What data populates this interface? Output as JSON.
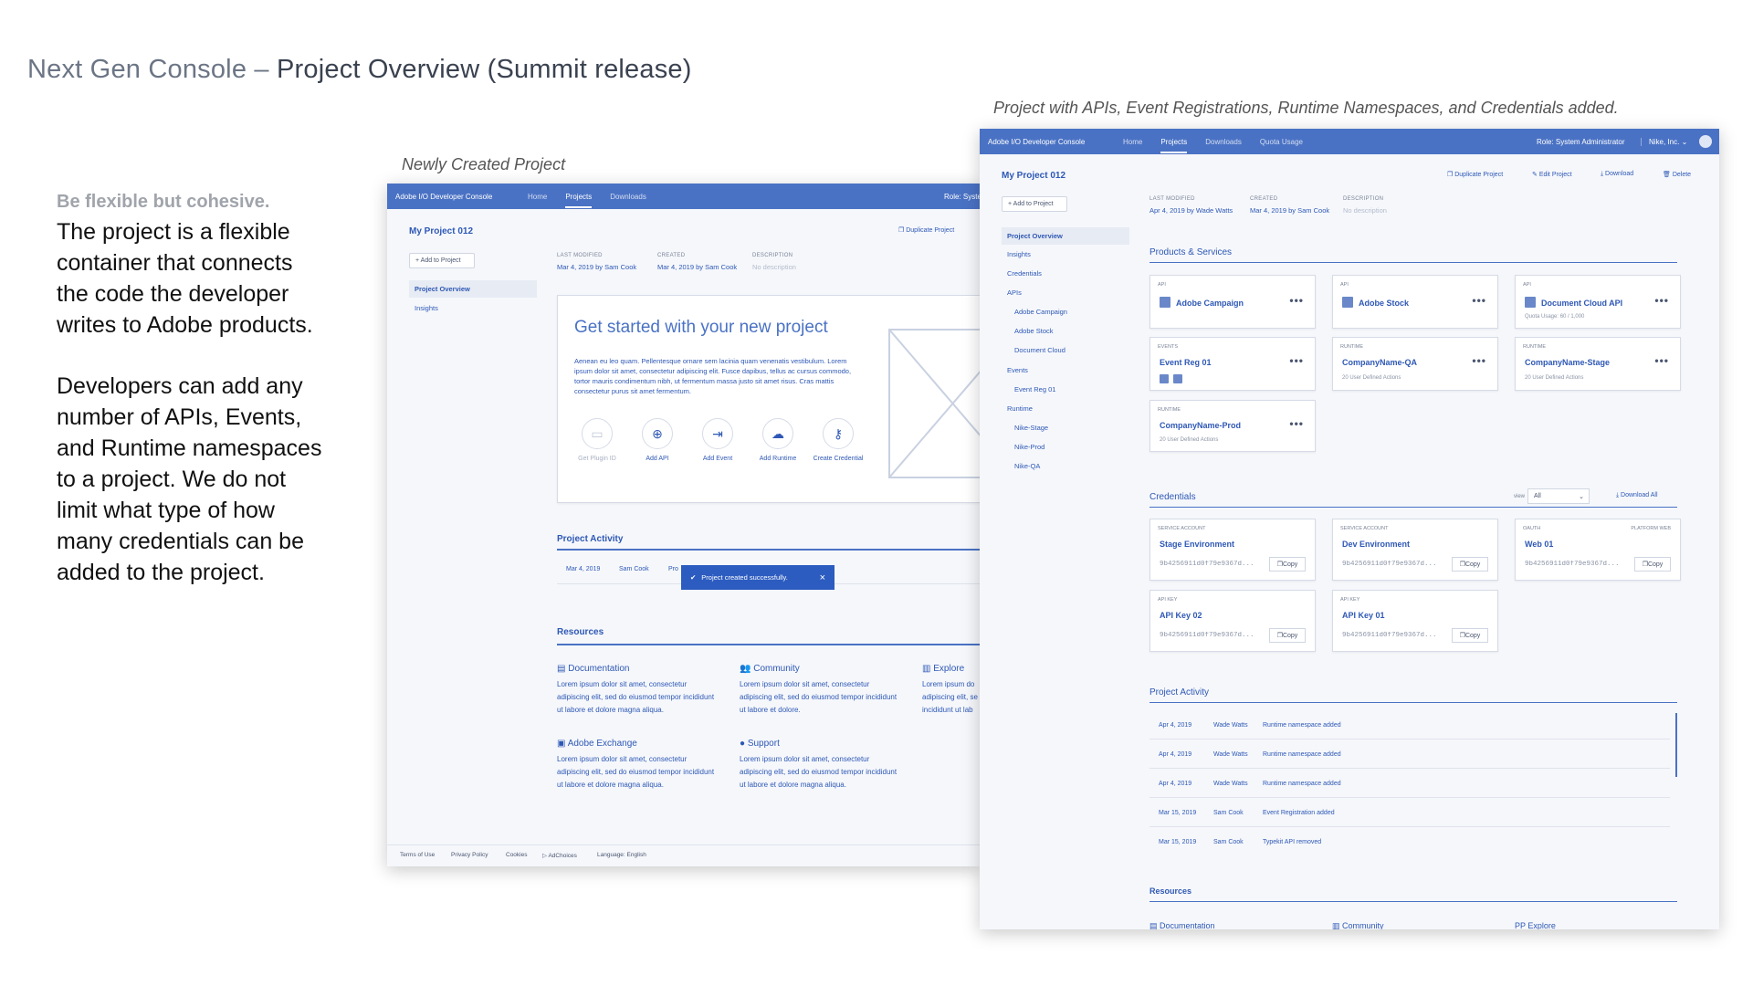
{
  "slide": {
    "title_prefix": "Next Gen Console – ",
    "title_main": "Project Overview  (Summit release)",
    "caption_left": "Newly Created  Project",
    "caption_right": "Project  with APIs, Event Registrations,  Runtime Namespaces,  and Credentials added.",
    "side_heading": "Be flexible but cohesive.",
    "side_p1": "The project is a flexible container that connects the code the developer writes to Adobe products.",
    "side_p2": "Developers can add any number of APIs, Events, and Runtime namespaces to a project. We do not limit what type of how many credentials can be added to the project."
  },
  "left": {
    "brand": "Adobe I/O Developer Console",
    "nav": [
      "Home",
      "Projects",
      "Downloads"
    ],
    "role": "Role: Syste",
    "project_name": "My Project 012",
    "add_button": "+ Add to Project",
    "duplicate": "Duplicate Project",
    "sidebar": [
      "Project Overview",
      "Insights"
    ],
    "meta": {
      "modified_label": "LAST MODIFIED",
      "modified_value": "Mar 4, 2019 by Sam Cook",
      "created_label": "CREATED",
      "created_value": "Mar 4, 2019 by Sam Cook",
      "desc_label": "DESCRIPTION",
      "desc_value": "No description"
    },
    "get_started": {
      "title": "Get started with your new project",
      "body": "Aenean eu leo quam. Pellentesque ornare sem lacinia quam venenatis vestibulum. Lorem ipsum dolor sit amet, consectetur adipiscing elit. Fusce dapibus, tellus ac cursus commodo, tortor mauris condimentum nibh, ut fermentum massa justo sit amet risus. Cras mattis consectetur purus sit amet fermentum.",
      "actions": [
        "Get Plugin ID",
        "Add API",
        "Add Event",
        "Add Runtime",
        "Create Credential"
      ]
    },
    "activity": {
      "title": "Project Activity",
      "row": {
        "date": "Mar 4, 2019",
        "user": "Sam Cook",
        "event": "Pro"
      }
    },
    "toast": "Project created successfully.",
    "toast_close": "×",
    "resources": {
      "title": "Resources",
      "items": [
        {
          "title": "Documentation",
          "body": "Lorem ipsum dolor sit amet, consectetur adipiscing elit, sed do eiusmod tempor incididunt ut labore et dolore magna aliqua."
        },
        {
          "title": "Community",
          "body": "Lorem ipsum dolor sit amet, consectetur adipiscing elit, sed do eiusmod tempor incididunt ut labore et dolore."
        },
        {
          "title": "Explore",
          "body": "Lorem ipsum do adipiscing elit, se incididunt ut lab"
        },
        {
          "title": "Adobe Exchange",
          "body": "Lorem ipsum dolor sit amet, consectetur adipiscing elit, sed do eiusmod tempor incididunt ut labore et dolore magna aliqua."
        },
        {
          "title": "Support",
          "body": "Lorem ipsum dolor sit amet, consectetur adipiscing elit, sed do eiusmod tempor incididunt ut labore et dolore magna aliqua."
        }
      ]
    },
    "footer": [
      "Terms of Use",
      "Privacy Policy",
      "Cookies",
      "AdChoices",
      "Language: English"
    ]
  },
  "right": {
    "brand": "Adobe I/O Developer Console",
    "nav": [
      "Home",
      "Projects",
      "Downloads",
      "Quota Usage"
    ],
    "role": "Role: System Administrator",
    "org": "Nike, Inc.",
    "project_name": "My Project 012",
    "add_button": "+ Add to Project",
    "toolbar": [
      "Duplicate Project",
      "Edit Project",
      "Download",
      "Delete"
    ],
    "meta": {
      "modified_label": "LAST MODIFIED",
      "modified_value": "Apr 4, 2019 by Wade Watts",
      "created_label": "CREATED",
      "created_value": "Mar 4, 2019 by Sam Cook",
      "desc_label": "DESCRIPTION",
      "desc_value": "No description"
    },
    "sidebar": [
      "Project Overview",
      "Insights",
      "Credentials",
      "APIs",
      "Adobe Campaign",
      "Adobe Stock",
      "Document Cloud",
      "Events",
      "Event Reg 01",
      "Runtime",
      "Nike-Stage",
      "Nike-Prod",
      "Nike-QA"
    ],
    "products_title": "Products & Services",
    "products": [
      {
        "kind": "API",
        "name": "Adobe Campaign",
        "sub": ""
      },
      {
        "kind": "API",
        "name": "Adobe Stock",
        "sub": ""
      },
      {
        "kind": "API",
        "name": "Document Cloud API",
        "sub": "Quota Usage: 60 / 1,000"
      },
      {
        "kind": "EVENTS",
        "name": "Event Reg 01",
        "sub": ""
      },
      {
        "kind": "RUNTIME",
        "name": "CompanyName-QA",
        "sub": "20 User Defined Actions"
      },
      {
        "kind": "RUNTIME",
        "name": "CompanyName-Stage",
        "sub": "20 User Defined Actions"
      },
      {
        "kind": "RUNTIME",
        "name": "CompanyName-Prod",
        "sub": "20 User Defined Actions"
      }
    ],
    "more": "•••",
    "credentials_title": "Credentials",
    "view_label": "view",
    "view_value": "All",
    "download_all": "Download All",
    "credentials": [
      {
        "kind": "SERVICE ACCOUNT",
        "name": "Stage Environment",
        "hash": "9b4256911d0f79e9367d...",
        "platform": ""
      },
      {
        "kind": "SERVICE ACCOUNT",
        "name": "Dev Environment",
        "hash": "9b4256911d0f79e9367d...",
        "platform": ""
      },
      {
        "kind": "OAUTH",
        "name": "Web 01",
        "hash": "9b4256911d0f79e9367d...",
        "platform": "PLATFORM WEB"
      },
      {
        "kind": "API KEY",
        "name": "API Key 02",
        "hash": "9b4256911d0f79e9367d...",
        "platform": ""
      },
      {
        "kind": "API KEY",
        "name": "API Key 01",
        "hash": "9b4256911d0f79e9367d...",
        "platform": ""
      }
    ],
    "copy_label": "Copy",
    "activity_title": "Project Activity",
    "activity": [
      {
        "date": "Apr 4, 2019",
        "user": "Wade Watts",
        "event": "Runtime namespace added"
      },
      {
        "date": "Apr 4, 2019",
        "user": "Wade Watts",
        "event": "Runtime namespace added"
      },
      {
        "date": "Apr 4, 2019",
        "user": "Wade Watts",
        "event": "Runtime namespace added"
      },
      {
        "date": "Mar 15, 2019",
        "user": "Sam Cook",
        "event": "Event Registration added"
      },
      {
        "date": "Mar 15, 2019",
        "user": "Sam Cook",
        "event": "Typekit API removed"
      }
    ],
    "resources_title": "Resources",
    "resources": [
      "Documentation",
      "Community",
      "PP Explore"
    ]
  }
}
